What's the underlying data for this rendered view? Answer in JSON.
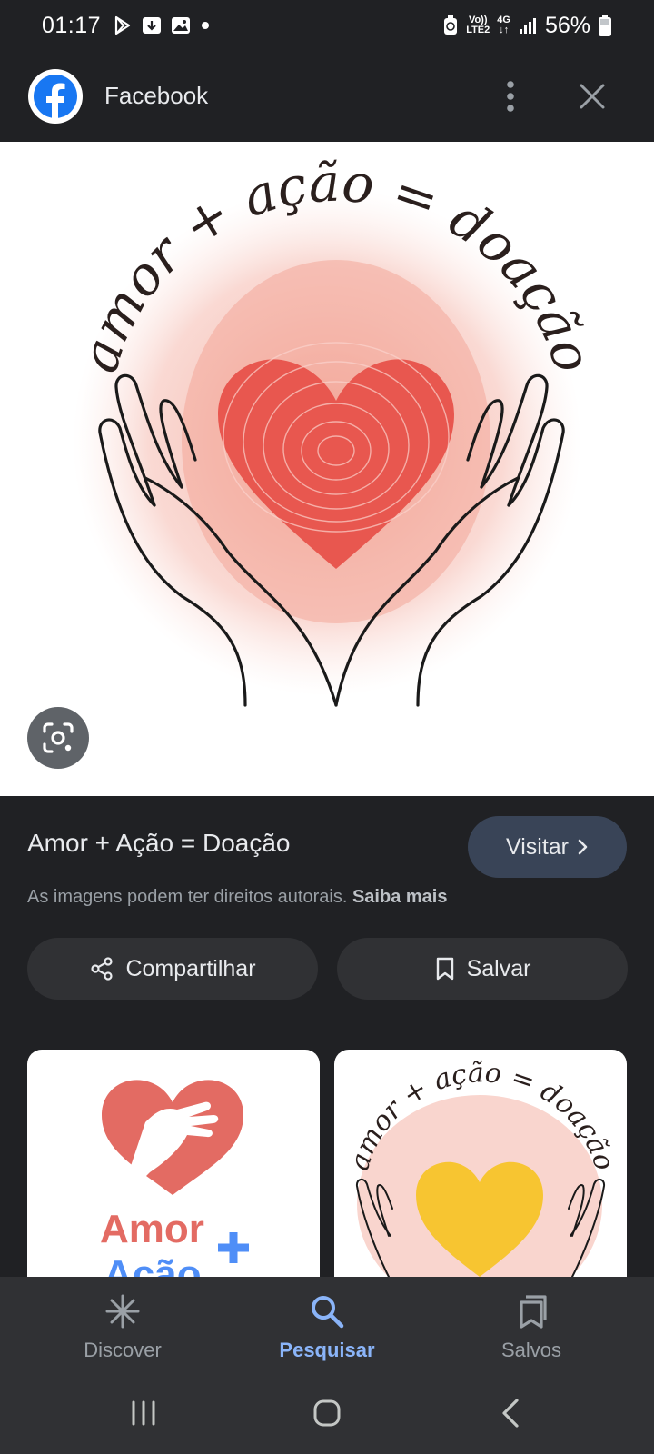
{
  "status_bar": {
    "time": "01:17",
    "network_top": "Vo))",
    "network_bottom": "LTE2",
    "network_type": "4G",
    "battery": "56%"
  },
  "header": {
    "source_name": "Facebook",
    "logo_icon": "facebook-icon",
    "more_icon": "more-vert-icon",
    "close_icon": "close-icon"
  },
  "image": {
    "arc_text": "amor + ação = doação",
    "lens_icon": "google-lens-icon"
  },
  "info": {
    "title": "Amor + Ação = Doação",
    "visit_label": "Visitar",
    "copyright_text": "As imagens podem ter direitos autorais.",
    "learn_more": "Saiba mais",
    "share_label": "Compartilhar",
    "save_label": "Salvar"
  },
  "related": [
    {
      "logo_line1": "Amor",
      "logo_line2": "Ação"
    },
    {
      "arc_text": "amor + ação = doação"
    }
  ],
  "bottom_nav": {
    "items": [
      {
        "label": "Discover",
        "icon": "asterisk-icon"
      },
      {
        "label": "Pesquisar",
        "icon": "search-icon",
        "active": true
      },
      {
        "label": "Salvos",
        "icon": "bookmarks-icon"
      }
    ]
  },
  "colors": {
    "background": "#202124",
    "accent": "#8ab4f8",
    "visit_button": "#394457",
    "heart": "#e8574f",
    "brand_coral": "#e36b63"
  }
}
